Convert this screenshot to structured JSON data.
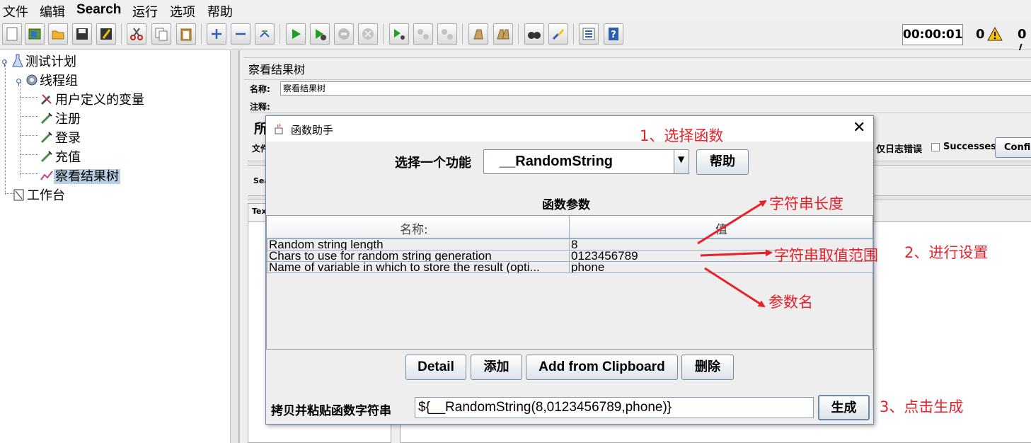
{
  "menubar": {
    "items": [
      "文件",
      "编辑",
      "Search",
      "运行",
      "选项",
      "帮助"
    ]
  },
  "toolbar": {
    "icons": [
      "new-icon",
      "templates-icon",
      "open-icon",
      "save-icon",
      "save-as-icon",
      "cut-icon",
      "copy-icon",
      "paste-icon",
      "expand-icon",
      "collapse-icon",
      "toggle-icon",
      "start-icon",
      "start-no-pause-icon",
      "stop-icon",
      "shutdown-icon",
      "remote-start-icon",
      "remote-stop-icon",
      "remote-shutdown-icon",
      "clear-icon",
      "clear-all-icon",
      "search-icon",
      "reset-search-icon",
      "function-helper-icon",
      "help-icon"
    ],
    "timer": "00:00:01",
    "warnings": "0",
    "active_threads": "0 /"
  },
  "tree": {
    "nodes": [
      "测试计划",
      "线程组",
      "用户定义的变量",
      "注册",
      "登录",
      "充值",
      "察看结果树",
      "工作台"
    ]
  },
  "panel": {
    "title": "察看结果树",
    "name_label": "名称:",
    "name_value": "察看结果树",
    "comment_label": "注释:",
    "section_cut": "所",
    "file_cut": "文件",
    "log_errors_label": "仅日志错误",
    "successes_label": "Successes",
    "configure_cut": "Configu",
    "search_cut": "Sea",
    "text_cut": "Tex"
  },
  "dialog": {
    "title": "函数助手",
    "function_label": "选择一个功能",
    "function_selected": "__RandomString",
    "help_button": "帮助",
    "params_heading": "函数参数",
    "col_name": "名称:",
    "col_value": "值",
    "rows": [
      {
        "name": "Random string length",
        "value": "8"
      },
      {
        "name": "Chars to use for random string generation",
        "value": "0123456789"
      },
      {
        "name": "Name of variable in which to store the result (opti...",
        "value": "phone"
      }
    ],
    "buttons": {
      "detail": "Detail",
      "add": "添加",
      "add_clipboard": "Add from Clipboard",
      "delete": "删除"
    },
    "copy_label": "拷贝并粘贴函数字符串",
    "result_value": "${__RandomString(8,0123456789,phone)}",
    "generate_button": "生成"
  },
  "annotations": {
    "select_function": "1、选择函数",
    "string_length": "字符串长度",
    "string_range": "字符串取值范围",
    "settings": "2、进行设置",
    "param_name": "参数名",
    "click_generate": "3、点击生成"
  },
  "colors": {
    "annotation": "#e8202a",
    "selection": "#b8cfe5",
    "border_accent": "#6f8aa6"
  }
}
